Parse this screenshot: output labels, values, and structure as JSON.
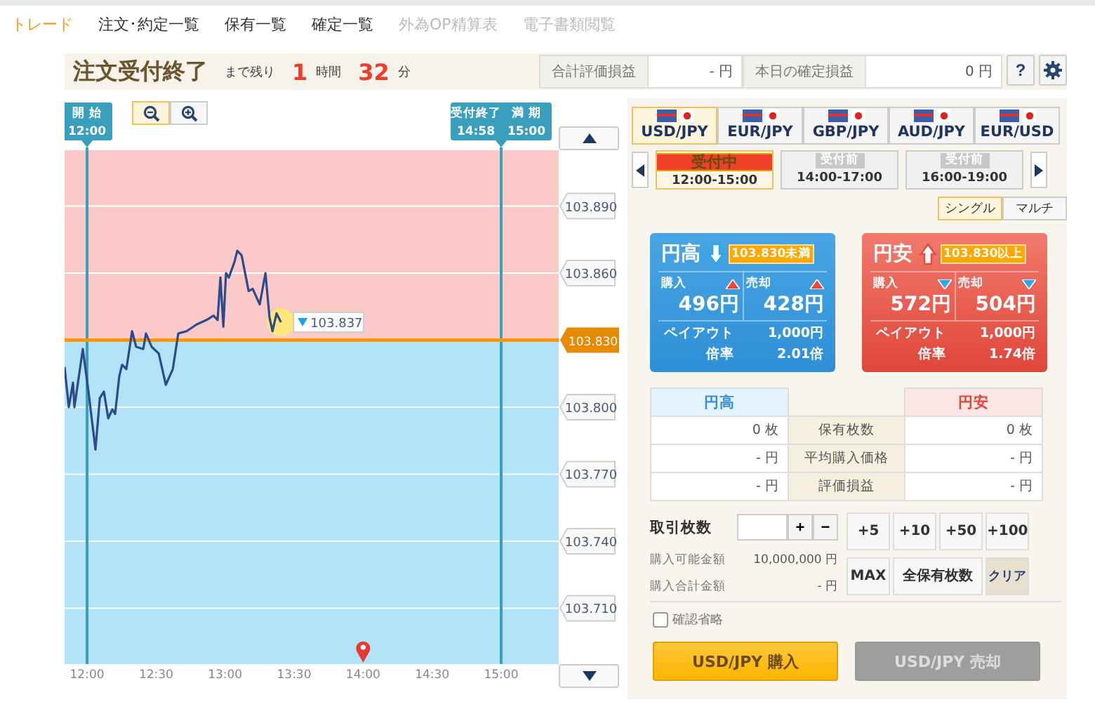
{
  "nav": [
    {
      "label": "トレード",
      "selected": true,
      "disabled": false
    },
    {
      "label": "注文･約定一覧",
      "selected": false,
      "disabled": false
    },
    {
      "label": "保有一覧",
      "selected": false,
      "disabled": false
    },
    {
      "label": "確定一覧",
      "selected": false,
      "disabled": false
    },
    {
      "label": "外為OP精算表",
      "selected": false,
      "disabled": true
    },
    {
      "label": "電子書類閲覧",
      "selected": false,
      "disabled": true
    }
  ],
  "status": {
    "title": "注文受付終了",
    "remaining_label": "まで残り",
    "hours": "1",
    "hours_unit": "時間",
    "minutes": "32",
    "minutes_unit": "分"
  },
  "summary": [
    {
      "label": "合計評価損益",
      "value": "- 円"
    },
    {
      "label": "本日の確定損益",
      "value": "0 円"
    }
  ],
  "help_button": "?",
  "chart": {
    "zoom": [
      {
        "kind": "out",
        "selected": true
      },
      {
        "kind": "in",
        "selected": false
      }
    ],
    "chart_data": {
      "type": "line",
      "xlim": [
        11.837,
        15.417
      ],
      "ylim": [
        103.685,
        103.915
      ],
      "xticks": [
        {
          "value": 12,
          "label": "12:00"
        },
        {
          "value": 12.5,
          "label": "12:30"
        },
        {
          "value": 13,
          "label": "13:00"
        },
        {
          "value": 13.5,
          "label": "13:30"
        },
        {
          "value": 14,
          "label": "14:00"
        },
        {
          "value": 14.5,
          "label": "14:30"
        },
        {
          "value": 15,
          "label": "15:00"
        }
      ],
      "yticks": [
        {
          "value": 103.89,
          "label": "103.890"
        },
        {
          "value": 103.86,
          "label": "103.860"
        },
        {
          "value": 103.8,
          "label": "103.800"
        },
        {
          "value": 103.77,
          "label": "103.770"
        },
        {
          "value": 103.74,
          "label": "103.740"
        },
        {
          "value": 103.71,
          "label": "103.710"
        }
      ],
      "x": [
        11.837,
        11.868,
        11.898,
        11.908,
        11.969,
        12.01,
        12.061,
        12.092,
        12.122,
        12.153,
        12.183,
        12.203,
        12.234,
        12.254,
        12.285,
        12.326,
        12.356,
        12.407,
        12.427,
        12.468,
        12.519,
        12.57,
        12.621,
        12.661,
        12.722,
        12.793,
        12.865,
        12.916,
        12.946,
        12.966,
        12.987,
        13.007,
        13.027,
        13.068,
        13.088,
        13.119,
        13.17,
        13.2,
        13.251,
        13.292,
        13.322,
        13.343,
        13.373,
        13.404
      ],
      "series": [
        {
          "color": "#2d4a8a",
          "values": [
            103.818,
            103.8,
            103.811,
            103.8,
            103.826,
            103.807,
            103.781,
            103.804,
            103.807,
            103.795,
            103.799,
            103.797,
            103.814,
            103.819,
            103.817,
            103.834,
            103.827,
            103.826,
            103.833,
            103.827,
            103.824,
            103.81,
            103.817,
            103.833,
            103.834,
            103.837,
            103.839,
            103.841,
            103.839,
            103.858,
            103.836,
            103.86,
            103.858,
            103.865,
            103.87,
            103.868,
            103.852,
            103.853,
            103.846,
            103.86,
            103.84,
            103.834,
            103.842,
            103.838
          ]
        }
      ],
      "grid": true,
      "ref_lines": [
        {
          "axis": "y",
          "value": 103.83,
          "label": "103.830",
          "color": "#ff9800"
        },
        {
          "axis": "x",
          "value": 12,
          "color": "#3a9fbd"
        },
        {
          "axis": "x",
          "value": 15,
          "color": "#3a9fbd"
        }
      ],
      "annotations": [
        {
          "x": 13.404,
          "y": 103.838,
          "text": "103.837"
        }
      ]
    },
    "markers": [
      {
        "columns": [
          {
            "title": "開 始",
            "time": "12:00"
          }
        ]
      },
      {
        "columns": [
          {
            "title": "受付終了",
            "time": "14:58"
          },
          {
            "title": "満 期",
            "time": "15:00"
          }
        ]
      }
    ]
  },
  "currencies": [
    {
      "label": "USD/JPY",
      "selected": true
    },
    {
      "label": "EUR/JPY",
      "selected": false
    },
    {
      "label": "GBP/JPY",
      "selected": false
    },
    {
      "label": "AUD/JPY",
      "selected": false
    },
    {
      "label": "EUR/USD",
      "selected": false
    }
  ],
  "sessions": [
    {
      "status": "受付中",
      "active": true,
      "time": "12:00-15:00",
      "selected": true
    },
    {
      "status": "受付前",
      "active": false,
      "time": "14:00-17:00",
      "selected": false
    },
    {
      "status": "受付前",
      "active": false,
      "time": "16:00-19:00",
      "selected": false
    }
  ],
  "modes": [
    {
      "label": "シングル",
      "selected": true
    },
    {
      "label": "マルチ",
      "selected": false
    }
  ],
  "cards": [
    {
      "kind": "high",
      "title": "円高",
      "arrow_up": false,
      "threshold": "103.830未満",
      "buy_label": "購入",
      "buy_up": true,
      "buy": "496円",
      "sell_label": "売却",
      "sell_up": true,
      "sell": "428円",
      "payout_label": "ペイアウト",
      "payout": "1,000円",
      "rate_label": "倍率",
      "rate": "2.01倍"
    },
    {
      "kind": "low",
      "title": "円安",
      "arrow_up": true,
      "threshold": "103.830以上",
      "buy_label": "購入",
      "buy_up": false,
      "buy": "572円",
      "sell_label": "売却",
      "sell_up": false,
      "sell": "504円",
      "payout_label": "ペイアウト",
      "payout": "1,000円",
      "rate_label": "倍率",
      "rate": "1.74倍"
    }
  ],
  "holdings": {
    "columns": [
      "円高",
      "円安"
    ],
    "rows": [
      {
        "left": "0 枚",
        "label": "保有枚数",
        "right": "0 枚"
      },
      {
        "left": "- 円",
        "label": "平均購入価格",
        "right": "- 円"
      },
      {
        "left": "- 円",
        "label": "評価損益",
        "right": "- 円"
      }
    ]
  },
  "order": {
    "quantity_label": "取引枚数",
    "plus": "+",
    "minus": "−",
    "info": [
      {
        "label": "購入可能金額",
        "value": "10,000,000 円"
      },
      {
        "label": "購入合計金額",
        "value": "- 円"
      }
    ],
    "quick": [
      {
        "label": "+5",
        "kind": "plain"
      },
      {
        "label": "+10",
        "kind": "plain"
      },
      {
        "label": "+50",
        "kind": "plain"
      },
      {
        "label": "+100",
        "kind": "plain"
      },
      {
        "label": "MAX",
        "kind": "plain"
      },
      {
        "label": "全保有枚数",
        "kind": "wide"
      },
      {
        "label": "クリア",
        "kind": "clear"
      }
    ],
    "skip_confirm": {
      "label": "確認省略",
      "checked": false
    },
    "actions": [
      {
        "label": "USD/JPY 購入",
        "disabled": false
      },
      {
        "label": "USD/JPY 売却",
        "disabled": true
      }
    ]
  }
}
